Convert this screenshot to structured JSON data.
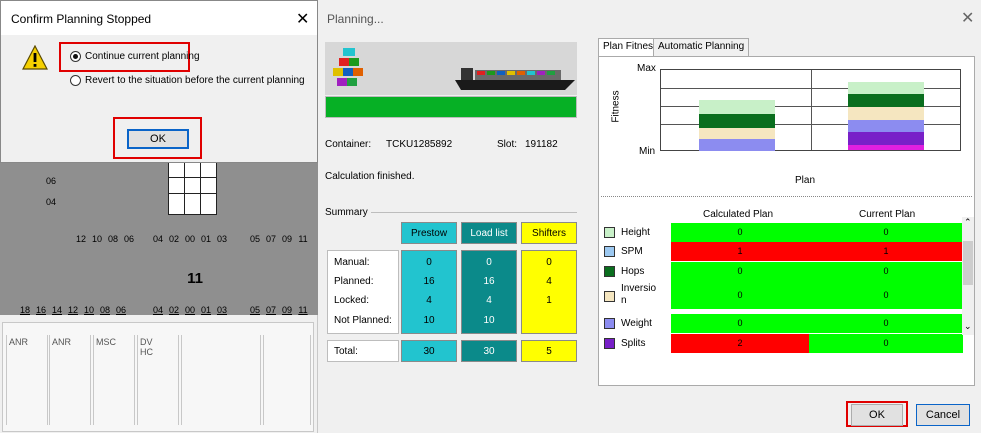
{
  "confirm_dialog": {
    "title": "Confirm Planning Stopped",
    "close": "✕",
    "option_continue": "Continue current planning",
    "option_revert": "Revert to the situation before the current planning",
    "ok_label": "OK"
  },
  "bay_view": {
    "tier_labels": [
      "06",
      "04"
    ],
    "row_numbers_top": [
      "12",
      "10",
      "08",
      "06",
      "04",
      "02",
      "00",
      "01",
      "03",
      "05",
      "07",
      "09",
      "11"
    ],
    "bay_number": "11",
    "row_numbers_bottom": [
      "18",
      "16",
      "14",
      "12",
      "10",
      "08",
      "06",
      "04",
      "02",
      "00",
      "01",
      "03",
      "05",
      "07",
      "09",
      "11"
    ],
    "ports": [
      "ANR",
      "ANR",
      "MSC",
      "DV\nHC",
      "",
      ""
    ]
  },
  "planning_dialog": {
    "title": "Planning...",
    "close": "✕",
    "container_label": "Container:",
    "container_value": "TCKU1285892",
    "slot_label": "Slot:",
    "slot_value": "191182",
    "status": "Calculation finished.",
    "summary_label": "Summary",
    "row_labels": [
      "Manual:",
      "Planned:",
      "Locked:",
      "Not Planned:"
    ],
    "total_label": "Total:",
    "columns": [
      {
        "name": "Prestow",
        "values": [
          "0",
          "16",
          "4",
          "10"
        ],
        "total": "30",
        "color": "#22c4cf"
      },
      {
        "name": "Load list",
        "values": [
          "0",
          "16",
          "4",
          "10"
        ],
        "total": "30",
        "color": "#0b8a8a"
      },
      {
        "name": "Shifters",
        "values": [
          "0",
          "4",
          "1",
          ""
        ],
        "total": "5",
        "color": "#ffff00"
      }
    ],
    "progress": 1.0,
    "ok_label": "OK",
    "cancel_label": "Cancel"
  },
  "plan_fitness": {
    "tabs": [
      "Plan Fitness",
      "Automatic Planning"
    ],
    "y_max": "Max",
    "y_min": "Min",
    "y_axis": "Fitness",
    "x_axis": "Plan",
    "col_calc": "Calculated Plan",
    "col_current": "Current Plan",
    "criteria": [
      {
        "name": "Height",
        "color": "#c8f0c8",
        "calc": "0",
        "current": "0",
        "calc_bg": "#00ff00",
        "current_bg": "#00ff00"
      },
      {
        "name": "SPM",
        "color": "#9cc8f0",
        "calc": "1",
        "current": "1",
        "calc_bg": "#ff0000",
        "current_bg": "#ff0000"
      },
      {
        "name": "Hops",
        "color": "#0a6e1e",
        "calc": "0",
        "current": "0",
        "calc_bg": "#00ff00",
        "current_bg": "#00ff00"
      },
      {
        "name": "Inversio\nn",
        "color": "#f5e6c0",
        "calc": "0",
        "current": "0",
        "calc_bg": "#00ff00",
        "current_bg": "#00ff00"
      },
      {
        "name": "Weight",
        "color": "#8c8cf0",
        "calc": "0",
        "current": "0",
        "calc_bg": "#00ff00",
        "current_bg": "#00ff00"
      },
      {
        "name": "Splits",
        "color": "#7820c8",
        "calc": "2",
        "current": "0",
        "calc_bg": "#ff0000",
        "current_bg": "#00ff00"
      }
    ]
  },
  "colors": {
    "accent_red": "#e00000",
    "progress_green": "#06b025"
  }
}
